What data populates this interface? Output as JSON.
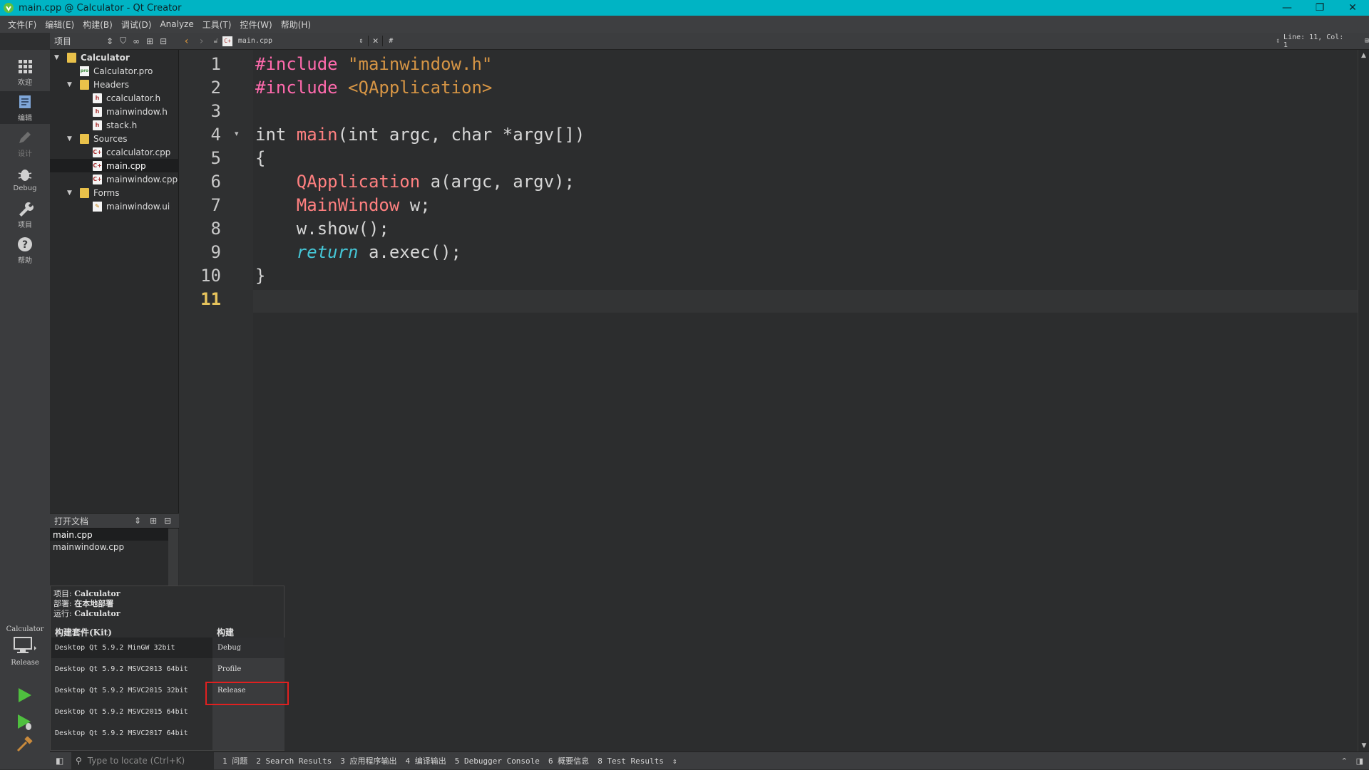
{
  "window": {
    "title": "main.cpp @ Calculator - Qt Creator",
    "controls": [
      "—",
      "❐",
      "✕"
    ]
  },
  "menu": [
    "文件(F)",
    "编辑(E)",
    "构建(B)",
    "调试(D)",
    "Analyze",
    "工具(T)",
    "控件(W)",
    "帮助(H)"
  ],
  "modes": [
    {
      "label": "欢迎",
      "icon": "grid-icon"
    },
    {
      "label": "编辑",
      "icon": "edit-icon",
      "active": true
    },
    {
      "label": "设计",
      "icon": "pencil-icon"
    },
    {
      "label": "Debug",
      "icon": "bug-icon"
    },
    {
      "label": "项目",
      "icon": "wrench-icon"
    },
    {
      "label": "帮助",
      "icon": "help-icon"
    }
  ],
  "projects": {
    "header": "项目",
    "tree": [
      {
        "label": "Calculator",
        "level": 0,
        "type": "folder",
        "expanded": true,
        "bold": true
      },
      {
        "label": "Calculator.pro",
        "level": 1,
        "type": "pro"
      },
      {
        "label": "Headers",
        "level": 1,
        "type": "folder",
        "expanded": true
      },
      {
        "label": "ccalculator.h",
        "level": 2,
        "type": "h"
      },
      {
        "label": "mainwindow.h",
        "level": 2,
        "type": "h"
      },
      {
        "label": "stack.h",
        "level": 2,
        "type": "h"
      },
      {
        "label": "Sources",
        "level": 1,
        "type": "folder",
        "expanded": true
      },
      {
        "label": "ccalculator.cpp",
        "level": 2,
        "type": "cpp"
      },
      {
        "label": "main.cpp",
        "level": 2,
        "type": "cpp",
        "selected": true
      },
      {
        "label": "mainwindow.cpp",
        "level": 2,
        "type": "cpp"
      },
      {
        "label": "Forms",
        "level": 1,
        "type": "folder",
        "expanded": true
      },
      {
        "label": "mainwindow.ui",
        "level": 2,
        "type": "ui"
      }
    ]
  },
  "open_docs": {
    "header": "打开文档",
    "items": [
      {
        "label": "main.cpp",
        "selected": true
      },
      {
        "label": "mainwindow.cpp"
      }
    ]
  },
  "editor": {
    "file_tab": "main.cpp",
    "symbol": "#",
    "position": "Line: 11, Col: 1",
    "lines": [
      {
        "n": "1",
        "tokens": [
          {
            "t": "#include ",
            "c": "kw-pre"
          },
          {
            "t": "\"mainwindow.h\"",
            "c": "str"
          }
        ]
      },
      {
        "n": "2",
        "tokens": [
          {
            "t": "#include ",
            "c": "kw-pre"
          },
          {
            "t": "<QApplication>",
            "c": "str"
          }
        ]
      },
      {
        "n": "3",
        "tokens": []
      },
      {
        "n": "4",
        "tokens": [
          {
            "t": "int ",
            "c": "type"
          },
          {
            "t": "main",
            "c": "fn"
          },
          {
            "t": "(int argc, char *argv[])",
            "c": "type"
          }
        ]
      },
      {
        "n": "5",
        "tokens": [
          {
            "t": "{",
            "c": "type"
          }
        ]
      },
      {
        "n": "6",
        "tokens": [
          {
            "t": "    ",
            "c": "type"
          },
          {
            "t": "QApplication",
            "c": "cls"
          },
          {
            "t": " a(argc, argv);",
            "c": "type"
          }
        ]
      },
      {
        "n": "7",
        "tokens": [
          {
            "t": "    ",
            "c": "type"
          },
          {
            "t": "MainWindow",
            "c": "cls"
          },
          {
            "t": " w;",
            "c": "type"
          }
        ]
      },
      {
        "n": "8",
        "tokens": [
          {
            "t": "    w.show();",
            "c": "type"
          }
        ]
      },
      {
        "n": "9",
        "tokens": [
          {
            "t": "    ",
            "c": "type"
          },
          {
            "t": "return",
            "c": "ret"
          },
          {
            "t": " a.exec();",
            "c": "type"
          }
        ]
      },
      {
        "n": "10",
        "tokens": [
          {
            "t": "}",
            "c": "type"
          }
        ]
      },
      {
        "n": "11",
        "tokens": [],
        "current": true
      }
    ]
  },
  "kit_selector": {
    "project_label": "项目:",
    "project_value": "Calculator",
    "deploy_label": "部署:",
    "deploy_value": "在本地部署",
    "run_label": "运行:",
    "run_value": "Calculator",
    "kit_header": "构建套件(Kit)",
    "build_header": "构建",
    "kits": [
      {
        "label": "Desktop Qt 5.9.2 MinGW 32bit",
        "selected": true
      },
      {
        "label": "Desktop Qt 5.9.2 MSVC2013 64bit"
      },
      {
        "label": "Desktop Qt 5.9.2 MSVC2015 32bit"
      },
      {
        "label": "Desktop Qt 5.9.2 MSVC2015 64bit"
      },
      {
        "label": "Desktop Qt 5.9.2 MSVC2017 64bit"
      }
    ],
    "builds": [
      {
        "label": "Debug",
        "selected": true
      },
      {
        "label": "Profile"
      },
      {
        "label": "Release",
        "highlighted": true
      }
    ]
  },
  "target": {
    "project": "Calculator",
    "config": "Release"
  },
  "statusbar": {
    "locator_placeholder": "Type to locate (Ctrl+K)",
    "tabs": [
      "1 问题",
      "2 Search Results",
      "3 应用程序输出",
      "4 编译输出",
      "5 Debugger Console",
      "6 概要信息",
      "8 Test Results"
    ]
  },
  "colors": {
    "titlebar": "#00b4c4",
    "highlight": "#e02020",
    "preprocessor": "#ff6aad",
    "string": "#d69545",
    "keyword_return": "#45c6d6",
    "class": "#ff8080",
    "current_line_number": "#e6c35c"
  }
}
